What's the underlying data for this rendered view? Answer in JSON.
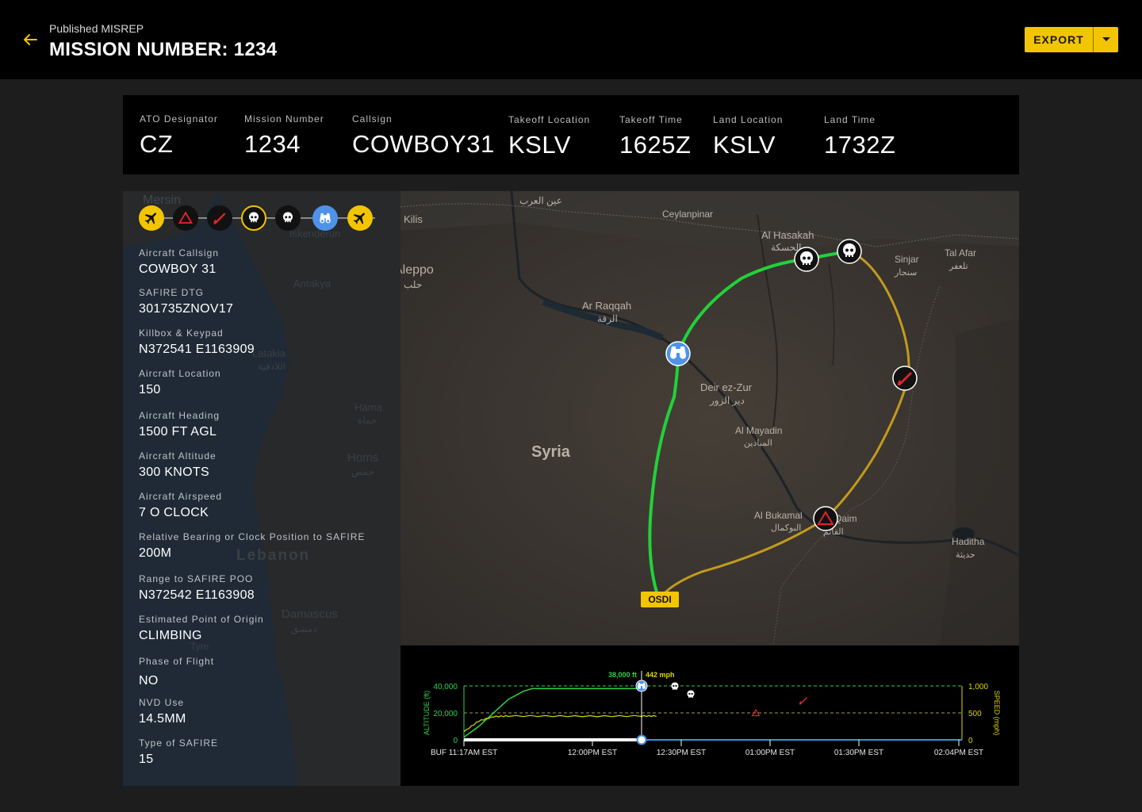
{
  "header": {
    "subtitle": "Published MISREP",
    "title": "MISSION NUMBER: 1234",
    "export_label": "EXPORT"
  },
  "summary": [
    {
      "label": "ATO Designator",
      "value": "CZ"
    },
    {
      "label": "Mission Number",
      "value": "1234"
    },
    {
      "label": "Callsign",
      "value": "COWBOY31"
    },
    {
      "label": "Takeoff Location",
      "value": "KSLV"
    },
    {
      "label": "Takeoff Time",
      "value": "1625Z"
    },
    {
      "label": "Land Location",
      "value": "KSLV"
    },
    {
      "label": "Land Time",
      "value": "1732Z"
    }
  ],
  "event_icons": [
    "airplane-icon",
    "warning-triangle-icon",
    "missile-icon",
    "skull-icon",
    "skull-icon",
    "binoculars-icon",
    "airplane-icon"
  ],
  "details": [
    {
      "label": "Aircraft Callsign",
      "value": "COWBOY 31"
    },
    {
      "label": "SAFIRE DTG",
      "value": "301735ZNOV17"
    },
    {
      "label": "Killbox & Keypad",
      "value": "N372541 E1163909"
    },
    {
      "label": "Aircraft Location",
      "value": "150"
    },
    {
      "label": "Aircraft Heading",
      "value": "1500 FT AGL"
    },
    {
      "label": "Aircraft Altitude",
      "value": "300 KNOTS"
    },
    {
      "label": "Aircraft Airspeed",
      "value": "7 O CLOCK"
    },
    {
      "label": "Relative Bearing or Clock Position to SAFIRE",
      "value": "200M"
    },
    {
      "label": "Range to SAFIRE POO",
      "value": "N372542 E1163908"
    },
    {
      "label": "Estimated Point of Origin",
      "value": "CLIMBING"
    },
    {
      "label": "Phase of Flight",
      "value": "NO"
    },
    {
      "label": "NVD Use",
      "value": "14.5MM"
    },
    {
      "label": "Type of SAFIRE",
      "value": "15"
    }
  ],
  "side_map_labels": {
    "mersin": "Mersin",
    "iskenderun": "Iskenderun",
    "antakya": "Antakya",
    "latakia": "Latakia",
    "latakia_ar": "اللاذقية",
    "hama": "Hama",
    "hama_ar": "حماة",
    "homs": "Homs",
    "homs_ar": "حمص",
    "lebanon": "Lebanon",
    "damascus": "Damascus",
    "damascus_ar": "دمشق",
    "tyre": "Tyre"
  },
  "map": {
    "route_label": "OSDI",
    "labels": {
      "kilis": "Kilis",
      "ain_al_arab": "عين العرب",
      "ceylanpinar": "Ceylanpinar",
      "al_hasakah": "Al Hasakah",
      "al_hasakah_ar": "الحسكة",
      "sinjar": "Sinjar",
      "sinjar_ar": "سنجار",
      "tal_afar": "Tal Afar",
      "tal_afar_ar": "تلعفر",
      "aleppo": "Aleppo",
      "aleppo_ar": "حلب",
      "ar_raqqah": "Ar Raqqah",
      "ar_raqqah_ar": "الرقة",
      "deir_ez_zur": "Deir ez-Zur",
      "deir_ez_zur_ar": "دير الزور",
      "al_mayadin": "Al Mayadin",
      "al_mayadin_ar": "الميادين",
      "syria": "Syria",
      "al_bukamal": "Al Bukamal",
      "al_bukamal_ar": "البوكمال",
      "qaim": "Qaim",
      "qaim_ar": "القائم",
      "haditha": "Haditha",
      "haditha_ar": "حديثة"
    },
    "colors": {
      "outbound": "#22d13a",
      "inbound": "#c39a1d"
    }
  },
  "chart_data": {
    "type": "line",
    "x_ticks": [
      "BUF 11:17AM EST",
      "12:00PM EST",
      "12:30PM EST",
      "01:00PM EST",
      "01:30PM EST",
      "02:04PM EST"
    ],
    "ylabel": "ALTITUDE (ft)",
    "y2label": "SPEED (mph)",
    "ylim": [
      0,
      40000
    ],
    "y2lim": [
      0,
      1000
    ],
    "y_ticks": [
      "40,000",
      "20,000",
      "0"
    ],
    "y2_ticks": [
      "1,000",
      "500",
      "0"
    ],
    "series": [
      {
        "name": "ALTITUDE (ft)",
        "color": "#2fd24a",
        "points": [
          [
            0,
            2000
          ],
          [
            5,
            10000
          ],
          [
            10,
            20000
          ],
          [
            15,
            30000
          ],
          [
            20,
            36000
          ],
          [
            23,
            38000
          ],
          [
            60,
            38000
          ]
        ]
      },
      {
        "name": "SPEED (mph)",
        "color": "#dcd800",
        "points": [
          [
            0,
            150
          ],
          [
            5,
            350
          ],
          [
            10,
            430
          ],
          [
            15,
            442
          ],
          [
            30,
            440
          ],
          [
            45,
            438
          ],
          [
            60,
            442
          ],
          [
            65,
            442
          ]
        ]
      }
    ],
    "cursor": {
      "altitude": "38,000 ft",
      "speed": "442 mph"
    },
    "event_icons": [
      "binoculars-icon",
      "skull-icon",
      "skull-icon",
      "warning-triangle-icon",
      "missile-icon"
    ]
  }
}
